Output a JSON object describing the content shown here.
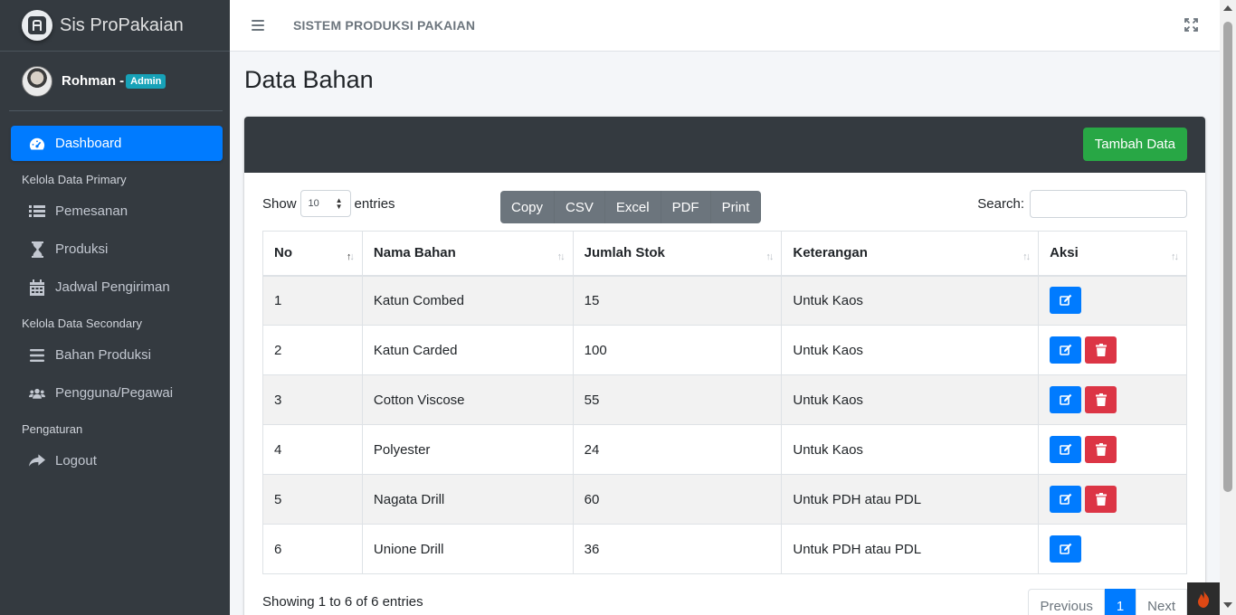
{
  "brand": {
    "name": "Sis ProPakaian"
  },
  "user": {
    "name": "Rohman -",
    "role": "Admin"
  },
  "sidebar": {
    "items": [
      {
        "label": "Dashboard",
        "icon": "tachometer-icon",
        "active": true
      },
      {
        "header": "Kelola Data Primary"
      },
      {
        "label": "Pemesanan",
        "icon": "list-icon"
      },
      {
        "label": "Produksi",
        "icon": "hourglass-icon"
      },
      {
        "label": "Jadwal Pengiriman",
        "icon": "calendar-icon"
      },
      {
        "header": "Kelola Data Secondary"
      },
      {
        "label": "Bahan Produksi",
        "icon": "bars-icon"
      },
      {
        "label": "Pengguna/Pegawai",
        "icon": "users-icon"
      },
      {
        "header": "Pengaturan"
      },
      {
        "label": "Logout",
        "icon": "share-icon"
      }
    ]
  },
  "topbar": {
    "title": "SISTEM PRODUKSI PAKAIAN"
  },
  "page": {
    "title": "Data Bahan"
  },
  "card": {
    "add_label": "Tambah Data"
  },
  "table_controls": {
    "show_label": "Show",
    "length_value": "10",
    "entries_label": "entries",
    "search_label": "Search:",
    "search_value": "",
    "export_buttons": [
      "Copy",
      "CSV",
      "Excel",
      "PDF",
      "Print"
    ]
  },
  "table": {
    "columns": [
      "No",
      "Nama Bahan",
      "Jumlah Stok",
      "Keterangan",
      "Aksi"
    ],
    "rows": [
      {
        "no": "1",
        "nama": "Katun Combed",
        "stok": "15",
        "ket": "Untuk Kaos",
        "delete": false
      },
      {
        "no": "2",
        "nama": "Katun Carded",
        "stok": "100",
        "ket": "Untuk Kaos",
        "delete": true
      },
      {
        "no": "3",
        "nama": "Cotton Viscose",
        "stok": "55",
        "ket": "Untuk Kaos",
        "delete": true
      },
      {
        "no": "4",
        "nama": "Polyester",
        "stok": "24",
        "ket": "Untuk Kaos",
        "delete": true
      },
      {
        "no": "5",
        "nama": "Nagata Drill",
        "stok": "60",
        "ket": "Untuk PDH atau PDL",
        "delete": true
      },
      {
        "no": "6",
        "nama": "Unione Drill",
        "stok": "36",
        "ket": "Untuk PDH atau PDL",
        "delete": false
      }
    ]
  },
  "footer": {
    "info": "Showing 1 to 6 of 6 entries",
    "previous": "Previous",
    "page": "1",
    "next": "Next"
  },
  "colors": {
    "sidebar": "#343a40",
    "primary": "#007bff",
    "success": "#28a745",
    "danger": "#dc3545",
    "secondary": "#6c757d",
    "info": "#17a2b8"
  }
}
